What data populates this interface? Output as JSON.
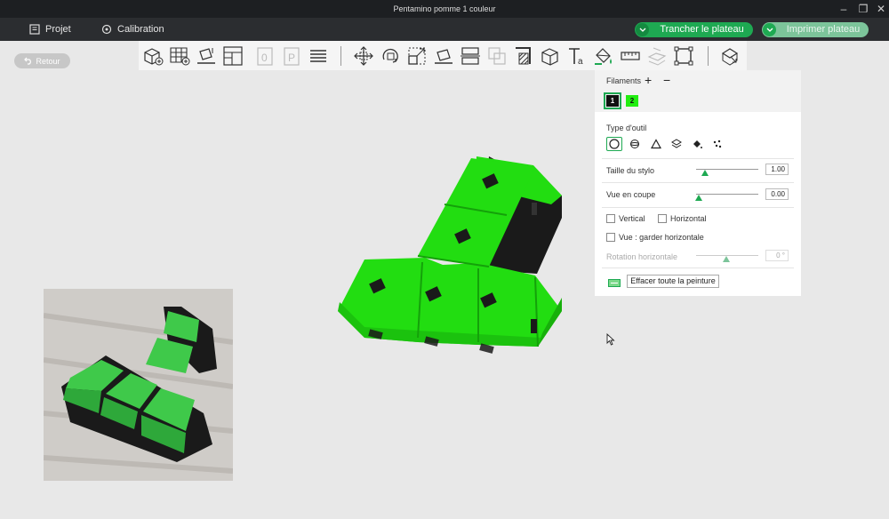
{
  "window": {
    "title": "Pentamino pomme 1 couleur"
  },
  "menu": {
    "project": "Projet",
    "calibration": "Calibration"
  },
  "actions": {
    "slice": "Trancher le plateau",
    "print": "Imprimer plateau"
  },
  "back": {
    "label": "Retour"
  },
  "toolbar": {
    "icons": [
      "add-object",
      "arrange-grid",
      "auto-orient",
      "layout",
      "plate-0",
      "plate-p",
      "layers",
      "move",
      "rotate",
      "scale",
      "lay-on-face",
      "cut",
      "boolean",
      "support-paint",
      "cube",
      "text",
      "paint",
      "measure",
      "assemble",
      "split",
      "settings-export"
    ]
  },
  "panel": {
    "filaments_label": "Filaments",
    "filament_1": "1",
    "filament_2": "2",
    "tool_type_label": "Type d'outil",
    "pen_size_label": "Taille du stylo",
    "pen_size_value": "1.00",
    "section_view_label": "Vue en coupe",
    "section_view_value": "0.00",
    "vertical_label": "Vertical",
    "horizontal_label": "Horizontal",
    "keep_horizontal_label": "Vue : garder horizontale",
    "horizontal_rotation_label": "Rotation horizontale",
    "horizontal_rotation_value": "0 °",
    "clear_paint_label": "Effacer toute la peinture"
  },
  "colors": {
    "accent": "#1ea952",
    "model_green": "#22dd11",
    "filament_1": "#111111",
    "filament_2": "#22ee11"
  }
}
